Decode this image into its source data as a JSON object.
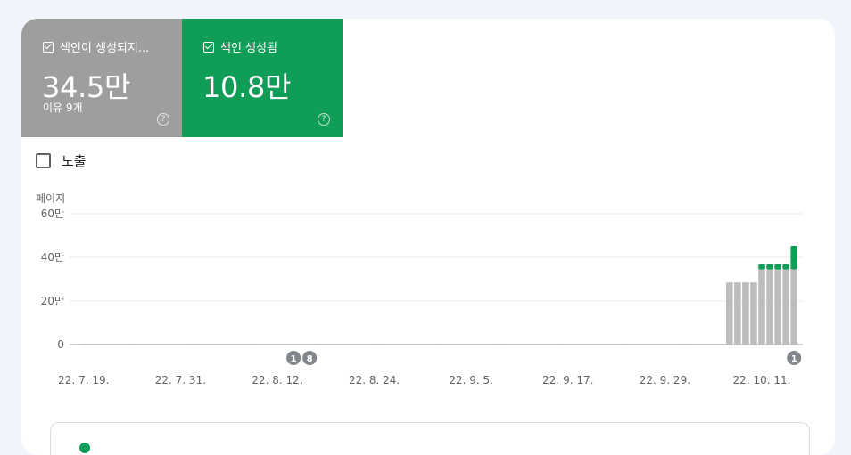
{
  "metrics": {
    "not_indexed": {
      "label": "색인이 생성되지...",
      "value": "34.5만",
      "sub": "이유 9개",
      "color": "#9e9e9e"
    },
    "indexed": {
      "label": "색인 생성됨",
      "value": "10.8만",
      "color": "#0f9d58"
    }
  },
  "impressions_label": "노출",
  "chart_data": {
    "type": "bar",
    "stacked": true,
    "ylabel": "페이지",
    "ylim": [
      0,
      600000
    ],
    "y_ticks": [
      {
        "value": 0,
        "label": "0"
      },
      {
        "value": 200000,
        "label": "20만"
      },
      {
        "value": 400000,
        "label": "40만"
      },
      {
        "value": 600000,
        "label": "60만"
      }
    ],
    "x_tick_labels": [
      "22. 7. 19.",
      "22. 7. 31.",
      "22. 8. 12.",
      "22. 8. 24.",
      "22. 9. 5.",
      "22. 9. 17.",
      "22. 9. 29.",
      "22. 10. 11."
    ],
    "start_date": "2022-07-19",
    "days": 89,
    "series": [
      {
        "name": "색인이 생성되지 않음",
        "color": "#bdbdbd",
        "values": [
          2000,
          2000,
          2000,
          2000,
          2000,
          2000,
          2000,
          2000,
          2000,
          2000,
          2000,
          2000,
          2000,
          2000,
          2000,
          2000,
          2000,
          2000,
          2000,
          2000,
          2000,
          2000,
          2000,
          2000,
          2000,
          2000,
          2000,
          2000,
          2000,
          2000,
          2000,
          2000,
          2000,
          2000,
          2000,
          2000,
          2000,
          2000,
          2000,
          2000,
          2000,
          2000,
          2000,
          2000,
          2000,
          2000,
          2000,
          2000,
          2000,
          2000,
          2000,
          2000,
          2000,
          2000,
          2000,
          2000,
          2000,
          2000,
          2000,
          2000,
          2000,
          2000,
          2000,
          2000,
          2000,
          2000,
          2000,
          2000,
          2000,
          2000,
          2000,
          2000,
          2000,
          2000,
          2000,
          2000,
          2000,
          2000,
          2000,
          2000,
          285000,
          285000,
          285000,
          285000,
          345000,
          345000,
          345000,
          345000,
          345000,
          345000,
          345000,
          345000,
          345000,
          345000
        ]
      },
      {
        "name": "색인 생성됨",
        "color": "#0f9d58",
        "values": [
          0,
          0,
          0,
          0,
          0,
          0,
          0,
          0,
          0,
          0,
          0,
          0,
          0,
          0,
          0,
          0,
          0,
          0,
          0,
          0,
          0,
          0,
          0,
          0,
          0,
          0,
          0,
          0,
          0,
          0,
          0,
          0,
          0,
          0,
          0,
          0,
          0,
          0,
          0,
          0,
          0,
          0,
          0,
          0,
          0,
          0,
          0,
          0,
          0,
          0,
          0,
          0,
          0,
          0,
          0,
          0,
          0,
          0,
          0,
          0,
          0,
          0,
          0,
          0,
          0,
          0,
          0,
          0,
          0,
          0,
          0,
          0,
          0,
          0,
          0,
          0,
          0,
          0,
          0,
          0,
          0,
          0,
          0,
          0,
          23000,
          23000,
          23000,
          23000,
          108000,
          108000,
          108000,
          108000,
          108000,
          108000
        ]
      }
    ],
    "annotations": [
      {
        "index": 26,
        "label": "1"
      },
      {
        "index": 28,
        "label": "8"
      },
      {
        "index": 88,
        "label": "1"
      }
    ],
    "grid": true
  }
}
